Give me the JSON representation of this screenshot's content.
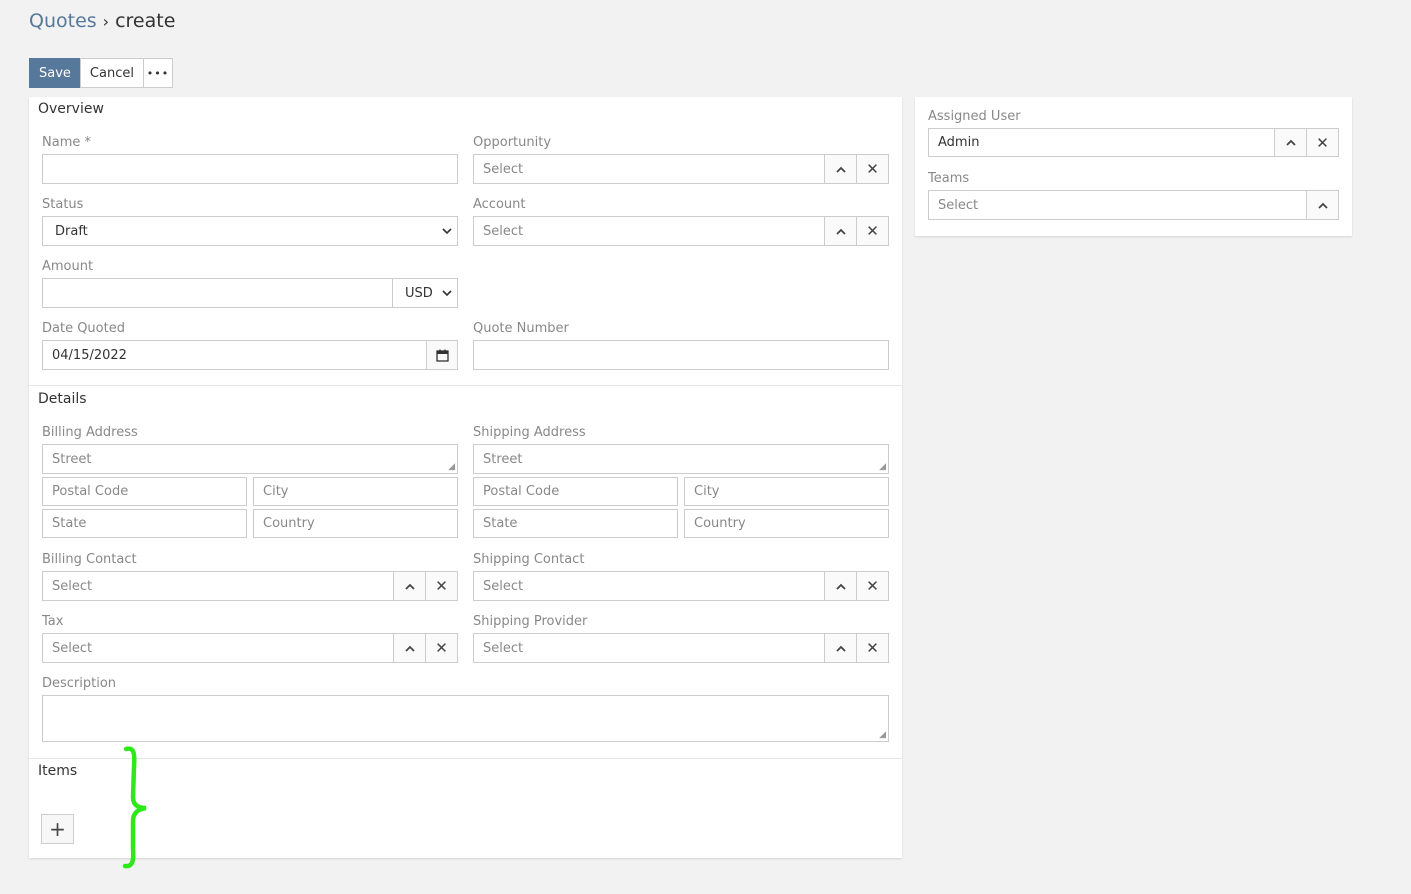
{
  "breadcrumb": {
    "parent": "Quotes",
    "separator": "›",
    "current": "create"
  },
  "toolbar": {
    "save_label": "Save",
    "cancel_label": "Cancel",
    "more_label": "•••"
  },
  "overview": {
    "title": "Overview",
    "name": {
      "label": "Name *",
      "value": ""
    },
    "opportunity": {
      "label": "Opportunity",
      "placeholder": "Select"
    },
    "status": {
      "label": "Status",
      "value": "Draft"
    },
    "account": {
      "label": "Account",
      "placeholder": "Select"
    },
    "amount": {
      "label": "Amount",
      "value": "",
      "currency": "USD"
    },
    "date_quoted": {
      "label": "Date Quoted",
      "value": "04/15/2022"
    },
    "quote_number": {
      "label": "Quote Number",
      "value": ""
    }
  },
  "details": {
    "title": "Details",
    "billing_address": {
      "label": "Billing Address",
      "street": "Street",
      "postal_code": "Postal Code",
      "city": "City",
      "state": "State",
      "country": "Country"
    },
    "shipping_address": {
      "label": "Shipping Address",
      "street": "Street",
      "postal_code": "Postal Code",
      "city": "City",
      "state": "State",
      "country": "Country"
    },
    "billing_contact": {
      "label": "Billing Contact",
      "placeholder": "Select"
    },
    "shipping_contact": {
      "label": "Shipping Contact",
      "placeholder": "Select"
    },
    "tax": {
      "label": "Tax",
      "placeholder": "Select"
    },
    "shipping_provider": {
      "label": "Shipping Provider",
      "placeholder": "Select"
    },
    "description": {
      "label": "Description",
      "value": ""
    }
  },
  "items": {
    "title": "Items",
    "add_label": "+"
  },
  "side": {
    "assigned_user": {
      "label": "Assigned User",
      "value": "Admin"
    },
    "teams": {
      "label": "Teams",
      "placeholder": "Select"
    }
  },
  "icons": {
    "up": "chevron-up-icon",
    "clear": "close-icon",
    "calendar": "calendar-icon",
    "dropdown": "chevron-down-icon"
  },
  "colors": {
    "primary": "#55789b",
    "annotation": "#2ee81a"
  }
}
